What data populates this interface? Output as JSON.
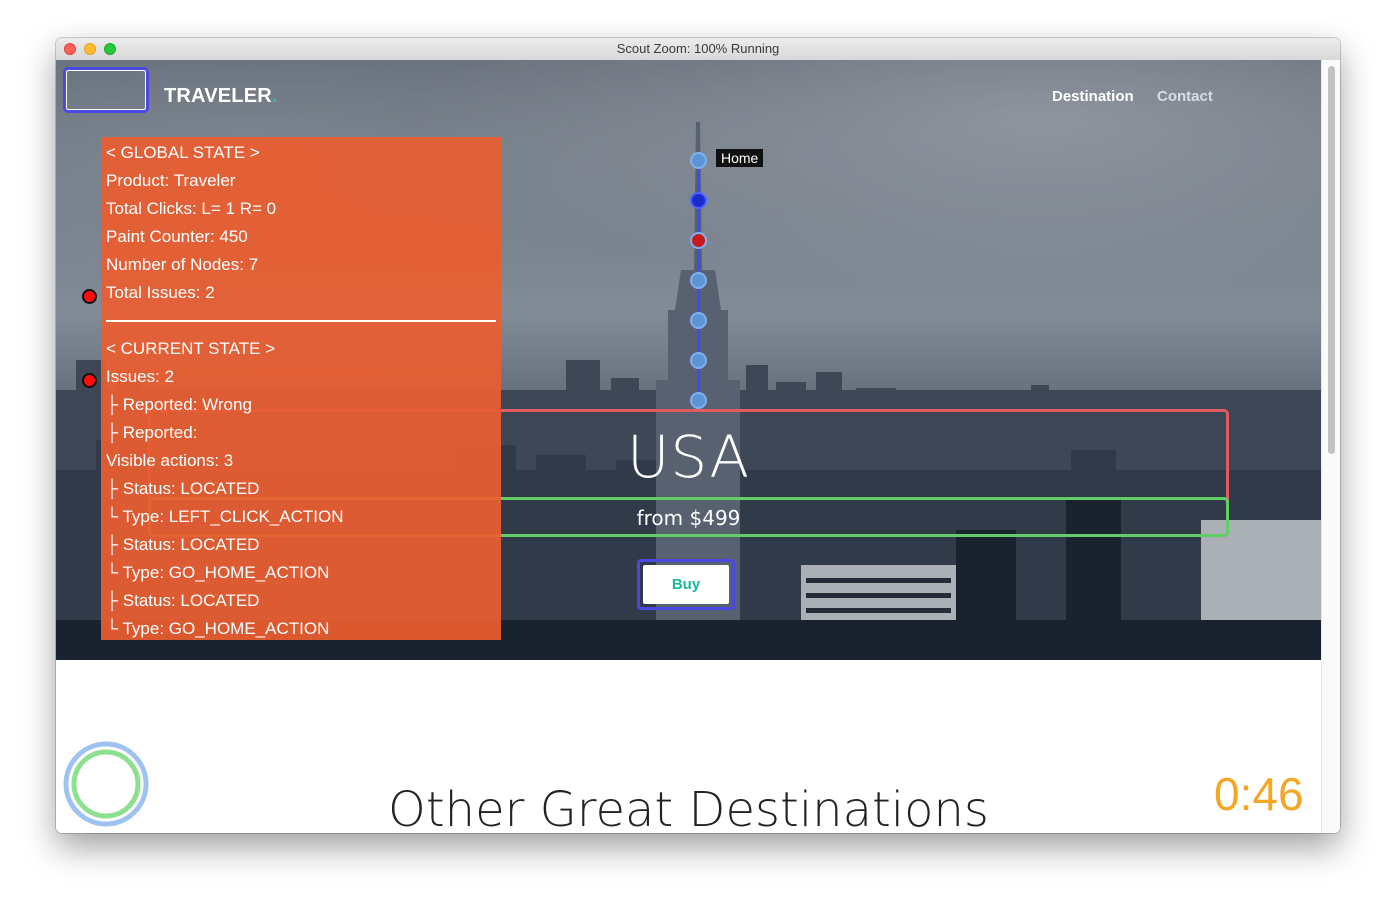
{
  "window": {
    "title": "Scout  Zoom: 100%  Running"
  },
  "header": {
    "brand": "TRAVELER",
    "brand_dot": ".",
    "nav": {
      "destination": "Destination",
      "contact": "Contact"
    }
  },
  "global_state": {
    "heading": "< GLOBAL STATE >",
    "product": "Product: Traveler",
    "total_clicks": "Total Clicks: L= 1 R= 0",
    "paint_counter": "Paint Counter: 450",
    "number_of_nodes": "Number of Nodes: 7",
    "total_issues": "Total Issues: 2"
  },
  "current_state": {
    "heading": "< CURRENT STATE >",
    "issues": "Issues: 2",
    "reported_1": "├ Reported: Wrong",
    "reported_2": "├ Reported:",
    "visible_actions": "Visible actions: 3",
    "actions": [
      {
        "status": "├ Status: LOCATED",
        "type": "└ Type: LEFT_CLICK_ACTION"
      },
      {
        "status": "├ Status: LOCATED",
        "type": "└ Type: GO_HOME_ACTION"
      },
      {
        "status": "├ Status: LOCATED",
        "type": "└ Type: GO_HOME_ACTION"
      }
    ]
  },
  "state_chain": {
    "home_label": "Home",
    "node_count": 7,
    "active_node_index": 1,
    "issue_node_index": 2
  },
  "hero": {
    "title": "USA",
    "price": "from $499",
    "buy_label": "Buy"
  },
  "section": {
    "title": "Other Great Destinations"
  },
  "timer": "0:46",
  "colors": {
    "panel": "#eb5e30",
    "accent": "#19b89a",
    "highlight_red": "#e15b62",
    "highlight_green": "#5fcf66",
    "focus_blue": "#4a4ae0",
    "timer": "#f5a623"
  }
}
